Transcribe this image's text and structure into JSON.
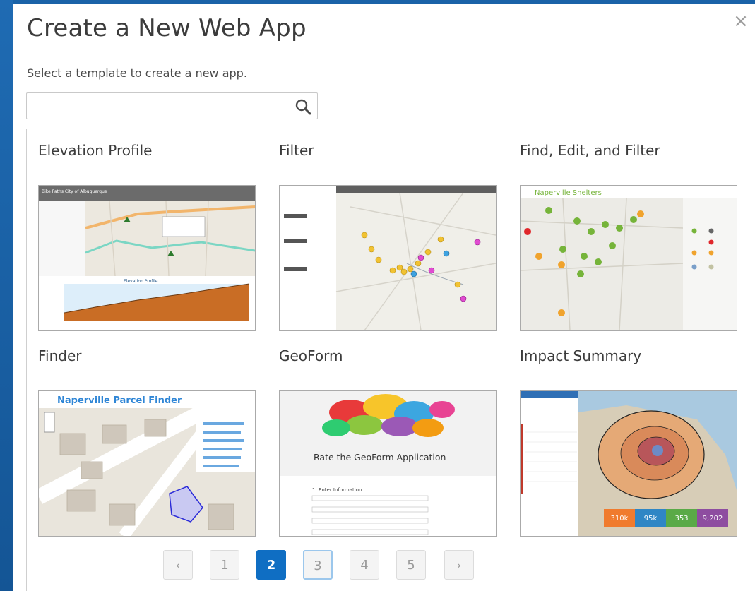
{
  "dialog": {
    "title": "Create a New Web App",
    "close_glyph": "×",
    "subtitle": "Select a template to create a new app.",
    "search": {
      "value": "",
      "placeholder": ""
    }
  },
  "templates": [
    {
      "name": "Elevation Profile",
      "thumb_title": "Bike Paths City of Albuquerque",
      "thumb_chart_title": "Elevation Profile"
    },
    {
      "name": "Filter"
    },
    {
      "name": "Find, Edit, and Filter",
      "thumb_title": "Naperville Shelters"
    },
    {
      "name": "Finder",
      "thumb_title": "Naperville Parcel Finder"
    },
    {
      "name": "GeoForm",
      "thumb_title": "Rate the GeoForm Application",
      "thumb_section": "1. Enter Information"
    },
    {
      "name": "Impact Summary",
      "thumb_stats": [
        "310k",
        "95k",
        "353",
        "9,202"
      ]
    }
  ],
  "pagination": {
    "prev": "‹",
    "next": "›",
    "pages": [
      "1",
      "2",
      "3",
      "4",
      "5"
    ],
    "current": "2",
    "focused": "3"
  },
  "colors": {
    "accent": "#0f6ec3",
    "background": "#1a63a8"
  },
  "icons": [
    "search-icon",
    "close-icon"
  ]
}
